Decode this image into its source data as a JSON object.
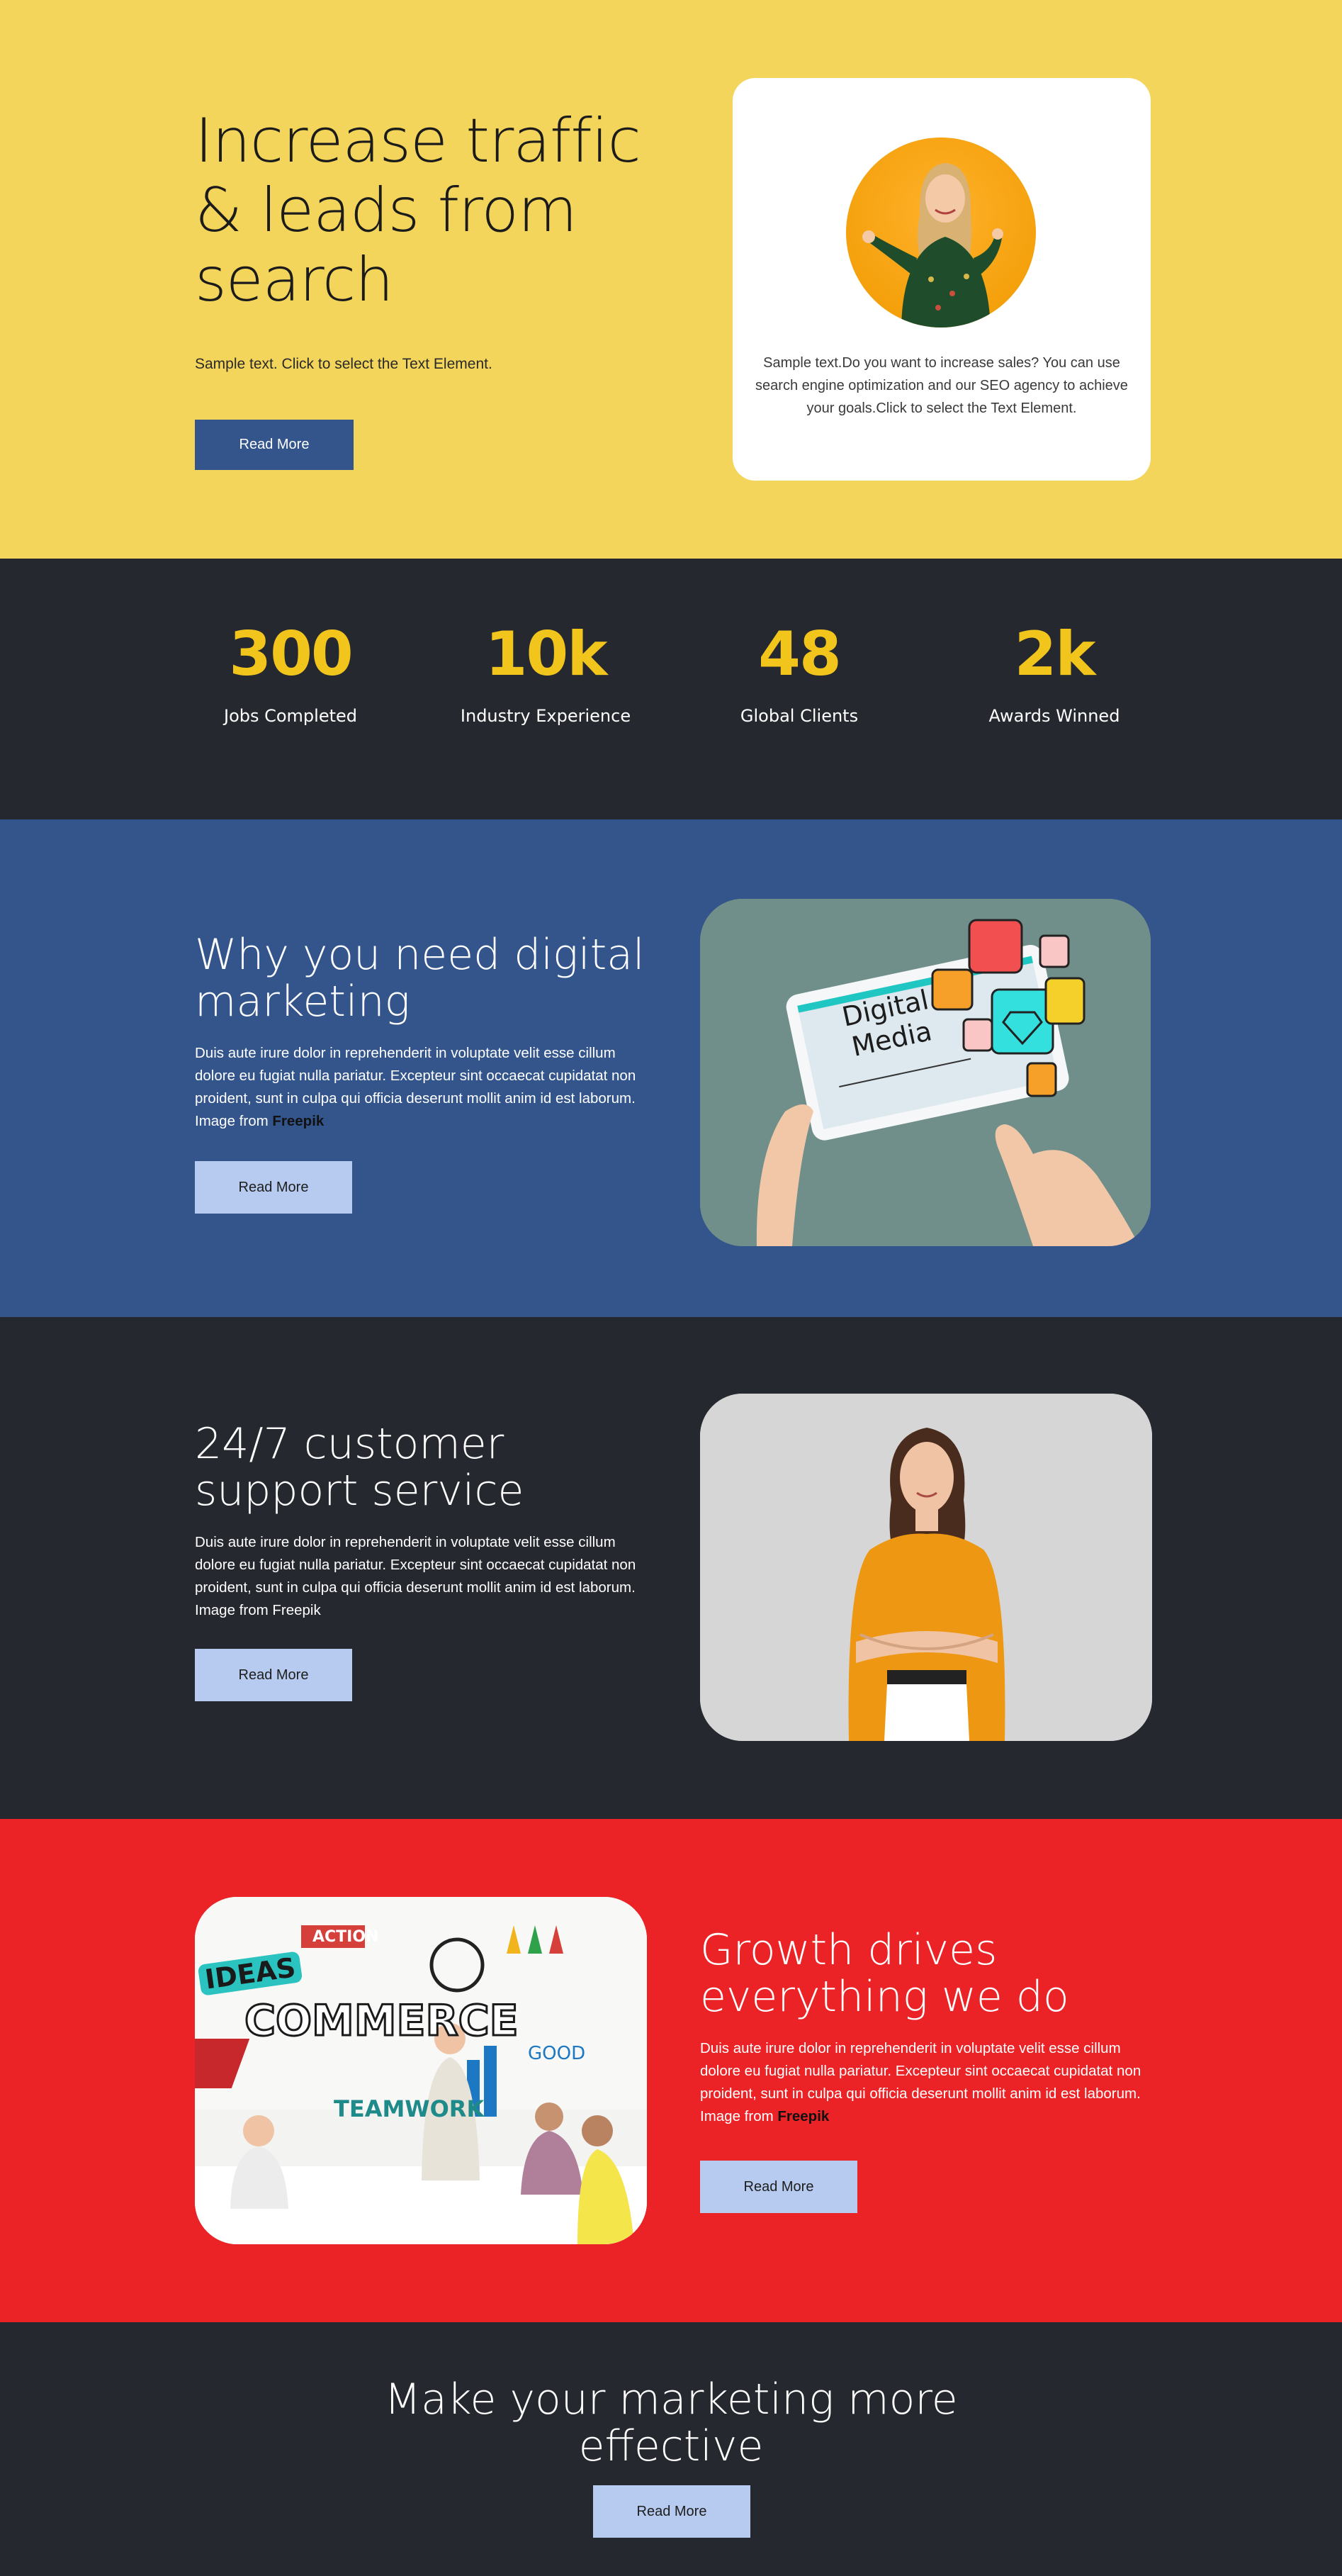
{
  "hero": {
    "title": "Increase traffic & leads from search",
    "text": "Sample text. Click to select the Text Element.",
    "button": "Read More",
    "card_text": "Sample text.Do you want to increase sales? You can use search engine optimization and our SEO agency to achieve your goals.Click to select the Text Element."
  },
  "stats": [
    {
      "value": "300",
      "label": "Jobs Completed"
    },
    {
      "value": "10k",
      "label": "Industry Experience"
    },
    {
      "value": "48",
      "label": "Global Clients"
    },
    {
      "value": "2k",
      "label": "Awards Winned"
    }
  ],
  "digital": {
    "title": "Why you need digital marketing",
    "body": "Duis aute irure dolor in reprehenderit in voluptate velit esse cillum dolore eu fugiat nulla pariatur. Excepteur sint occaecat cupidatat non proident, sunt in culpa qui officia deserunt mollit anim id est laborum. Image from",
    "link": "Freepik",
    "button": "Read More",
    "image_text_1": "Digital",
    "image_text_2": "Media"
  },
  "support": {
    "title": "24/7 customer support service",
    "body": "Duis aute irure dolor in reprehenderit in voluptate velit esse cillum dolore eu fugiat nulla pariatur. Excepteur sint occaecat cupidatat non proident, sunt in culpa qui officia deserunt mollit anim id est laborum. Image from Freepik",
    "button": "Read More"
  },
  "growth": {
    "title": "Growth drives everything we do",
    "body": "Duis aute irure dolor in reprehenderit in voluptate velit esse cillum dolore eu fugiat nulla pariatur. Excepteur sint occaecat cupidatat non proident, sunt in culpa qui officia deserunt mollit anim id est laborum. Image from",
    "link": "Freepik",
    "button": "Read More",
    "image_words": {
      "ideas": "IDEAS",
      "action": "ACTION",
      "commerce": "COMMERCE",
      "teamwork": "TEAMWORK",
      "good": "GOOD"
    }
  },
  "cta": {
    "title": "Make your marketing more effective",
    "button": "Read More"
  },
  "colors": {
    "yellow": "#f3d55b",
    "dark": "#262830",
    "blue": "#33558b",
    "red": "#ec2326",
    "stat_accent": "#f2c51c",
    "light_button": "#b7cbf0"
  }
}
